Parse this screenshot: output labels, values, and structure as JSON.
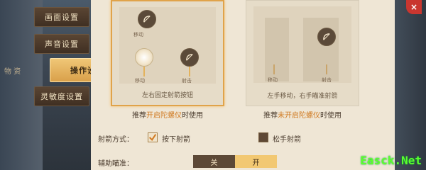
{
  "background": {
    "left_text": "物 资"
  },
  "menu": {
    "items": [
      {
        "label": "画面设置"
      },
      {
        "label": "声音设置"
      },
      {
        "label": "操作设置"
      },
      {
        "label": "灵敏度设置"
      }
    ],
    "active_index": 2
  },
  "cards": {
    "left": {
      "caption": "左右固定射箭按钮",
      "labels": {
        "move": "移动",
        "fire": "射击"
      },
      "hint": {
        "pre": "推荐",
        "highlight": "开启陀螺仪",
        "post": "时使用"
      }
    },
    "right": {
      "caption": "左手移动，右手瞄准射箭",
      "labels": {
        "move": "移动",
        "fire": "射击"
      },
      "hint": {
        "pre": "推荐",
        "highlight": "未开启陀螺仪",
        "post": "时使用"
      }
    }
  },
  "options": {
    "shoot_mode_label": "射箭方式：",
    "option_press": {
      "label": "按下射箭",
      "checked": true
    },
    "option_release": {
      "label": "松手射箭",
      "checked": false
    },
    "aim_assist_label": "辅助瞄准：",
    "toggle": {
      "off_label": "关",
      "on_label": "开",
      "selected": "on"
    }
  },
  "close_label": "×",
  "watermark": "Easck.Net",
  "colors": {
    "accent": "#e0a34a",
    "highlight": "#d07a21",
    "watermark": "#5cff2d"
  }
}
